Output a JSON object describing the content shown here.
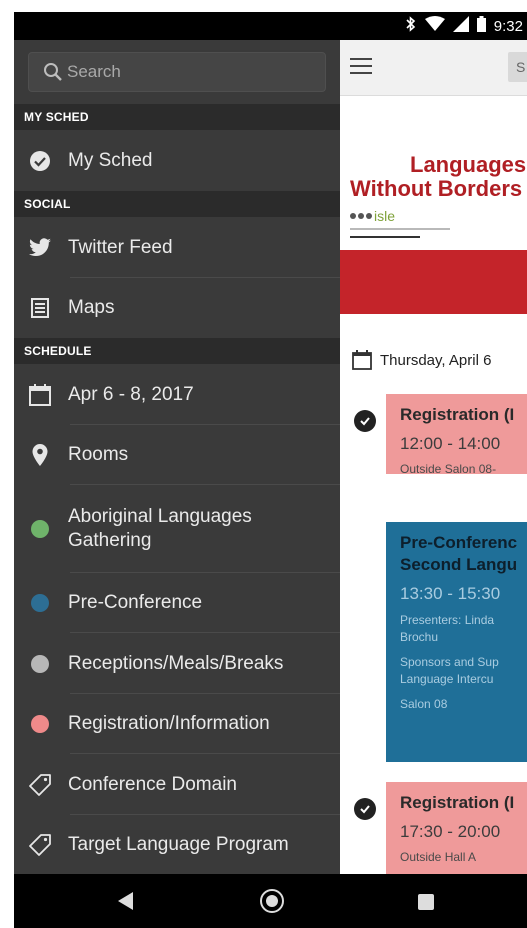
{
  "status_bar": {
    "time": "9:32",
    "icons": [
      "bluetooth-icon",
      "wifi-icon",
      "signal-icon",
      "battery-icon"
    ]
  },
  "drawer": {
    "search_placeholder": "Search",
    "sections": {
      "my_sched": "MY SCHED",
      "social": "SOCIAL",
      "schedule": "SCHEDULE"
    },
    "items": {
      "my_sched": "My Sched",
      "twitter": "Twitter Feed",
      "maps": "Maps",
      "dates": "Apr 6 - 8, 2017",
      "rooms": "Rooms",
      "aboriginal": "Aboriginal Languages Gathering",
      "preconf": "Pre-Conference",
      "receptions": "Receptions/Meals/Breaks",
      "registration": "Registration/Information",
      "conf_domain": "Conference Domain",
      "target_lang": "Target Language Program"
    },
    "colors": {
      "aboriginal": "#6fb36a",
      "preconf": "#2d6e94",
      "receptions": "#b7b7b7",
      "registration": "#ef8a8a"
    }
  },
  "main": {
    "search_button": "S",
    "banner": {
      "title_line1": "Languages",
      "title_line2": "Without Borders",
      "logo_text": "isle"
    },
    "day_label": "Thursday, April 6",
    "sessions": [
      {
        "title": "Registration (I",
        "time": "12:00 - 14:00",
        "location": "Outside Salon 08-"
      },
      {
        "title": "Pre-Conferenc",
        "title2": "Second Langu",
        "time": "13:30 - 15:30",
        "presenters": "Presenters: Linda",
        "presenters2": "Brochu",
        "sponsors": "Sponsors and Sup",
        "sponsors2": "Language Intercu",
        "location": "Salon 08"
      },
      {
        "title": "Registration (I",
        "time": "17:30 - 20:00",
        "location": "Outside Hall A"
      }
    ]
  }
}
